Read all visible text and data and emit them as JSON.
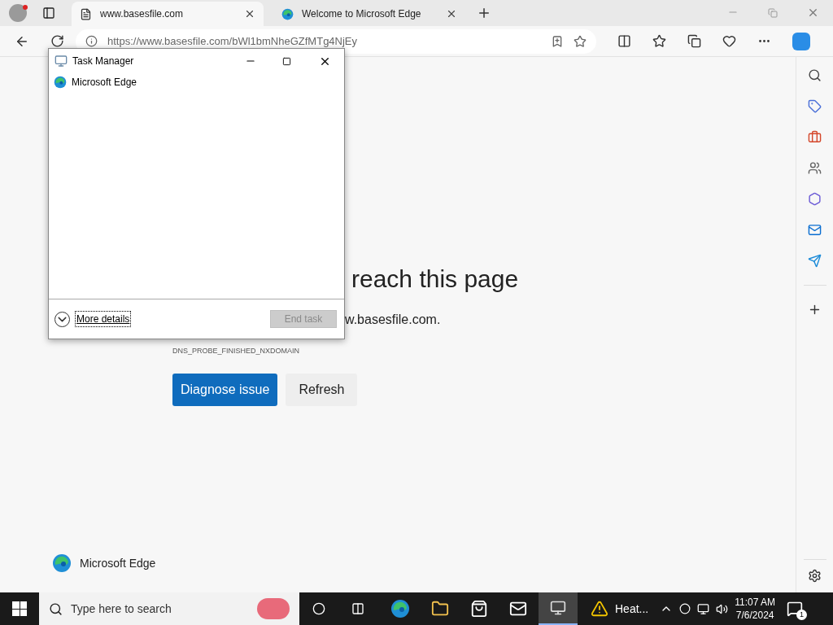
{
  "browser": {
    "tabs": [
      {
        "title": "www.basesfile.com",
        "selected": true
      },
      {
        "title": "Welcome to Microsoft Edge",
        "selected": false
      }
    ],
    "address": "https://www.basesfile.com/bWl1bmNheGZfMTg4NjEy"
  },
  "error_page": {
    "heading": "reach this page",
    "body": "w.basesfile.com.",
    "code": "DNS_PROBE_FINISHED_NXDOMAIN",
    "buttons": [
      {
        "label": "Diagnose issue",
        "kind": "primary"
      },
      {
        "label": "Refresh",
        "kind": "secondary"
      }
    ],
    "footer": "Microsoft Edge"
  },
  "task_manager": {
    "title": "Task Manager",
    "apps": [
      "Microsoft Edge"
    ],
    "more_details": "More details",
    "end_task": {
      "label": "End task",
      "disabled": true
    }
  },
  "taskbar": {
    "search_placeholder": "Type here to search",
    "weather": "Heat...",
    "time": "11:07 AM",
    "date": "7/6/2024",
    "notification_count": "1"
  }
}
